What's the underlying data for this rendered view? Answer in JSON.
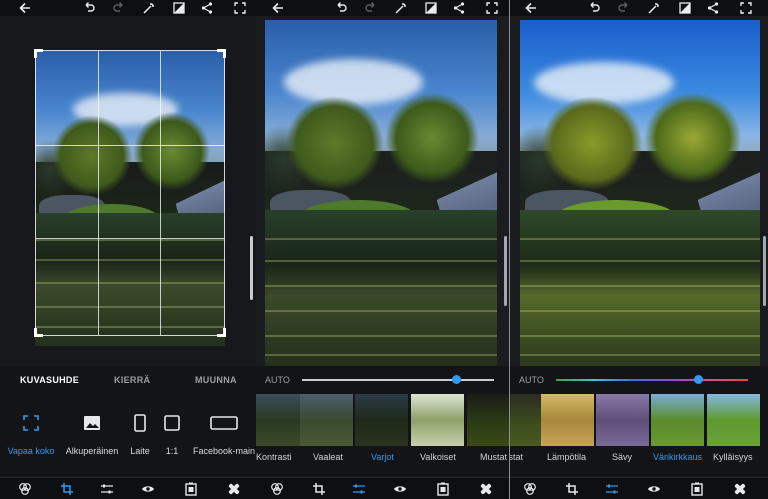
{
  "panels": [
    {
      "id": "crop",
      "tabs": [
        {
          "label": "KUVASUHDE",
          "active": true
        },
        {
          "label": "KIERRÄ",
          "active": false
        },
        {
          "label": "MUUNNA",
          "active": false
        }
      ],
      "tools": [
        {
          "label": "Vapaa koko",
          "icon": "free-crop-icon",
          "active": true
        },
        {
          "label": "Alkuperäinen",
          "icon": "image-icon",
          "active": false
        },
        {
          "label": "Laite",
          "icon": "phone-icon",
          "active": false
        },
        {
          "label": "1:1",
          "icon": "square-icon",
          "active": false
        },
        {
          "label": "Facebook-main",
          "icon": "wide-rect-icon",
          "active": false
        }
      ]
    },
    {
      "id": "adjust",
      "auto_label": "AUTO",
      "slider_value": 0.8,
      "filters": [
        {
          "label": "Kontrasti",
          "active": false
        },
        {
          "label": "Vaaleat",
          "active": false
        },
        {
          "label": "Varjot",
          "active": true
        },
        {
          "label": "Valkoiset",
          "active": false
        },
        {
          "label": "Mustat",
          "active": false
        }
      ]
    },
    {
      "id": "color",
      "auto_label": "AUTO",
      "slider_value": 0.74,
      "filters": [
        {
          "label": "tiistat",
          "active": false
        },
        {
          "label": "Lämpötila",
          "active": false
        },
        {
          "label": "Sävy",
          "active": false
        },
        {
          "label": "Värikirkkaus",
          "active": true
        },
        {
          "label": "Kylläisyys",
          "active": false
        }
      ]
    }
  ],
  "toolbar_icons": [
    "back-arrow-icon",
    "undo-icon",
    "redo-icon",
    "magic-wand-icon",
    "compare-icon",
    "share-icon",
    "fullscreen-icon"
  ],
  "bottom_icons": [
    "filters-icon",
    "crop-icon",
    "adjust-icon",
    "eye-icon",
    "frame-icon",
    "healing-icon"
  ],
  "colors": {
    "accent": "#2f9bf2",
    "background": "#16181c",
    "bar": "#0e0f12"
  }
}
